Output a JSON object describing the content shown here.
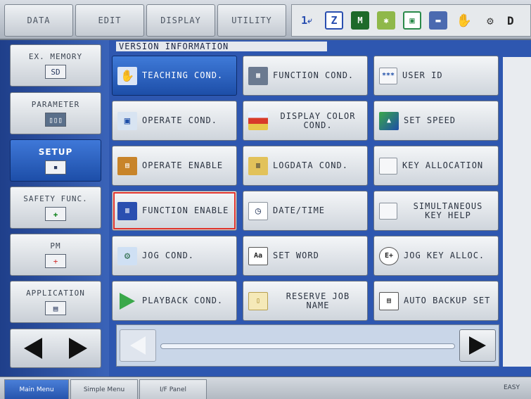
{
  "menu": {
    "tabs": [
      "DATA",
      "EDIT",
      "DISPLAY",
      "UTILITY"
    ]
  },
  "status": {
    "icons": [
      "step-1-icon",
      "cycle-icon",
      "manual-mode-icon",
      "security-icon",
      "coordinate-icon",
      "hold-icon",
      "hand-icon",
      "robot-icon"
    ],
    "step_text": "1",
    "overflow_label": "D"
  },
  "sidebar": {
    "items": [
      {
        "label": "EX. MEMORY",
        "icon": "sd-card-icon",
        "icon_text": "SD"
      },
      {
        "label": "PARAMETER",
        "icon": "parameter-icon",
        "icon_text": "▯▯▯"
      },
      {
        "label": "SETUP",
        "icon": "setup-icon",
        "icon_text": "▪"
      },
      {
        "label": "SAFETY FUNC.",
        "icon": "safety-icon",
        "icon_text": "✚"
      },
      {
        "label": "PM",
        "icon": "pm-icon",
        "icon_text": "+"
      },
      {
        "label": "APPLICATION",
        "icon": "application-icon",
        "icon_text": "▤"
      }
    ]
  },
  "main": {
    "title": "VERSION INFORMATION",
    "buttons": [
      {
        "label": "TEACHING COND.",
        "icon": "hand-icon"
      },
      {
        "label": "FUNCTION COND.",
        "icon": "function-cond-icon"
      },
      {
        "label": "USER ID",
        "icon": "user-id-icon"
      },
      {
        "label": "OPERATE COND.",
        "icon": "operate-cond-icon"
      },
      {
        "label": "DISPLAY COLOR COND.",
        "icon": "display-color-icon"
      },
      {
        "label": "SET SPEED",
        "icon": "speed-icon"
      },
      {
        "label": "OPERATE ENABLE",
        "icon": "operate-enable-icon"
      },
      {
        "label": "LOGDATA COND.",
        "icon": "logdata-icon"
      },
      {
        "label": "KEY ALLOCATION",
        "icon": "key-allocation-icon"
      },
      {
        "label": "FUNCTION ENABLE",
        "icon": "function-enable-icon"
      },
      {
        "label": "DATE/TIME",
        "icon": "clock-icon"
      },
      {
        "label": "SIMULTANEOUS KEY HELP",
        "icon": "key-help-icon"
      },
      {
        "label": "JOG COND.",
        "icon": "jog-cond-icon"
      },
      {
        "label": "SET WORD",
        "icon": "set-word-icon"
      },
      {
        "label": "JOG KEY ALLOC.",
        "icon": "jog-key-icon"
      },
      {
        "label": "PLAYBACK COND.",
        "icon": "playback-icon"
      },
      {
        "label": "RESERVE JOB NAME",
        "icon": "reserve-job-icon"
      },
      {
        "label": "AUTO BACKUP SET",
        "icon": "auto-backup-icon"
      }
    ],
    "user_id_icon_text": "***",
    "jog_key_icon_text": "E+",
    "set_word_icon_text": "Aa"
  },
  "bottom": {
    "tabs": [
      "Main Menu",
      "Simple Menu",
      "I/F Panel"
    ],
    "right_label": "EASY"
  },
  "colors": {
    "accent": "#2654ad",
    "highlight": "#e0322a",
    "panel_bg": "#2e57b0"
  }
}
